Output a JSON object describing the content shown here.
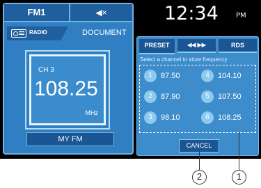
{
  "left_panel": {
    "tabs": {
      "band": "FM1",
      "mute_icon": "speaker-mute-icon",
      "mute_glyph": "◀×"
    },
    "source": {
      "radio_label": "RADIO",
      "document_label": "DOCUMENT"
    },
    "channel": "CH 3",
    "frequency": "108.25",
    "unit": "MHz",
    "myfm_label": "MY FM"
  },
  "clock": {
    "time": "12:34",
    "ampm": "PM"
  },
  "right_panel": {
    "tabs": {
      "preset": "PRESET",
      "seek": "◀◀ ▶▶",
      "rds": "RDS"
    },
    "instruction": "Select a channel to store frequency",
    "presets": [
      {
        "num": "1",
        "freq": "87.50"
      },
      {
        "num": "2",
        "freq": "87.90"
      },
      {
        "num": "3",
        "freq": "98.10"
      },
      {
        "num": "4",
        "freq": "104.10"
      },
      {
        "num": "5",
        "freq": "107.50"
      },
      {
        "num": "6",
        "freq": "108.25"
      }
    ],
    "cancel_label": "CANCEL"
  },
  "callouts": [
    "2",
    "1"
  ],
  "colors": {
    "panel_blue": "#2f7fc2",
    "dark_blue": "#1a5594",
    "accent_light": "#8ec9ef"
  }
}
